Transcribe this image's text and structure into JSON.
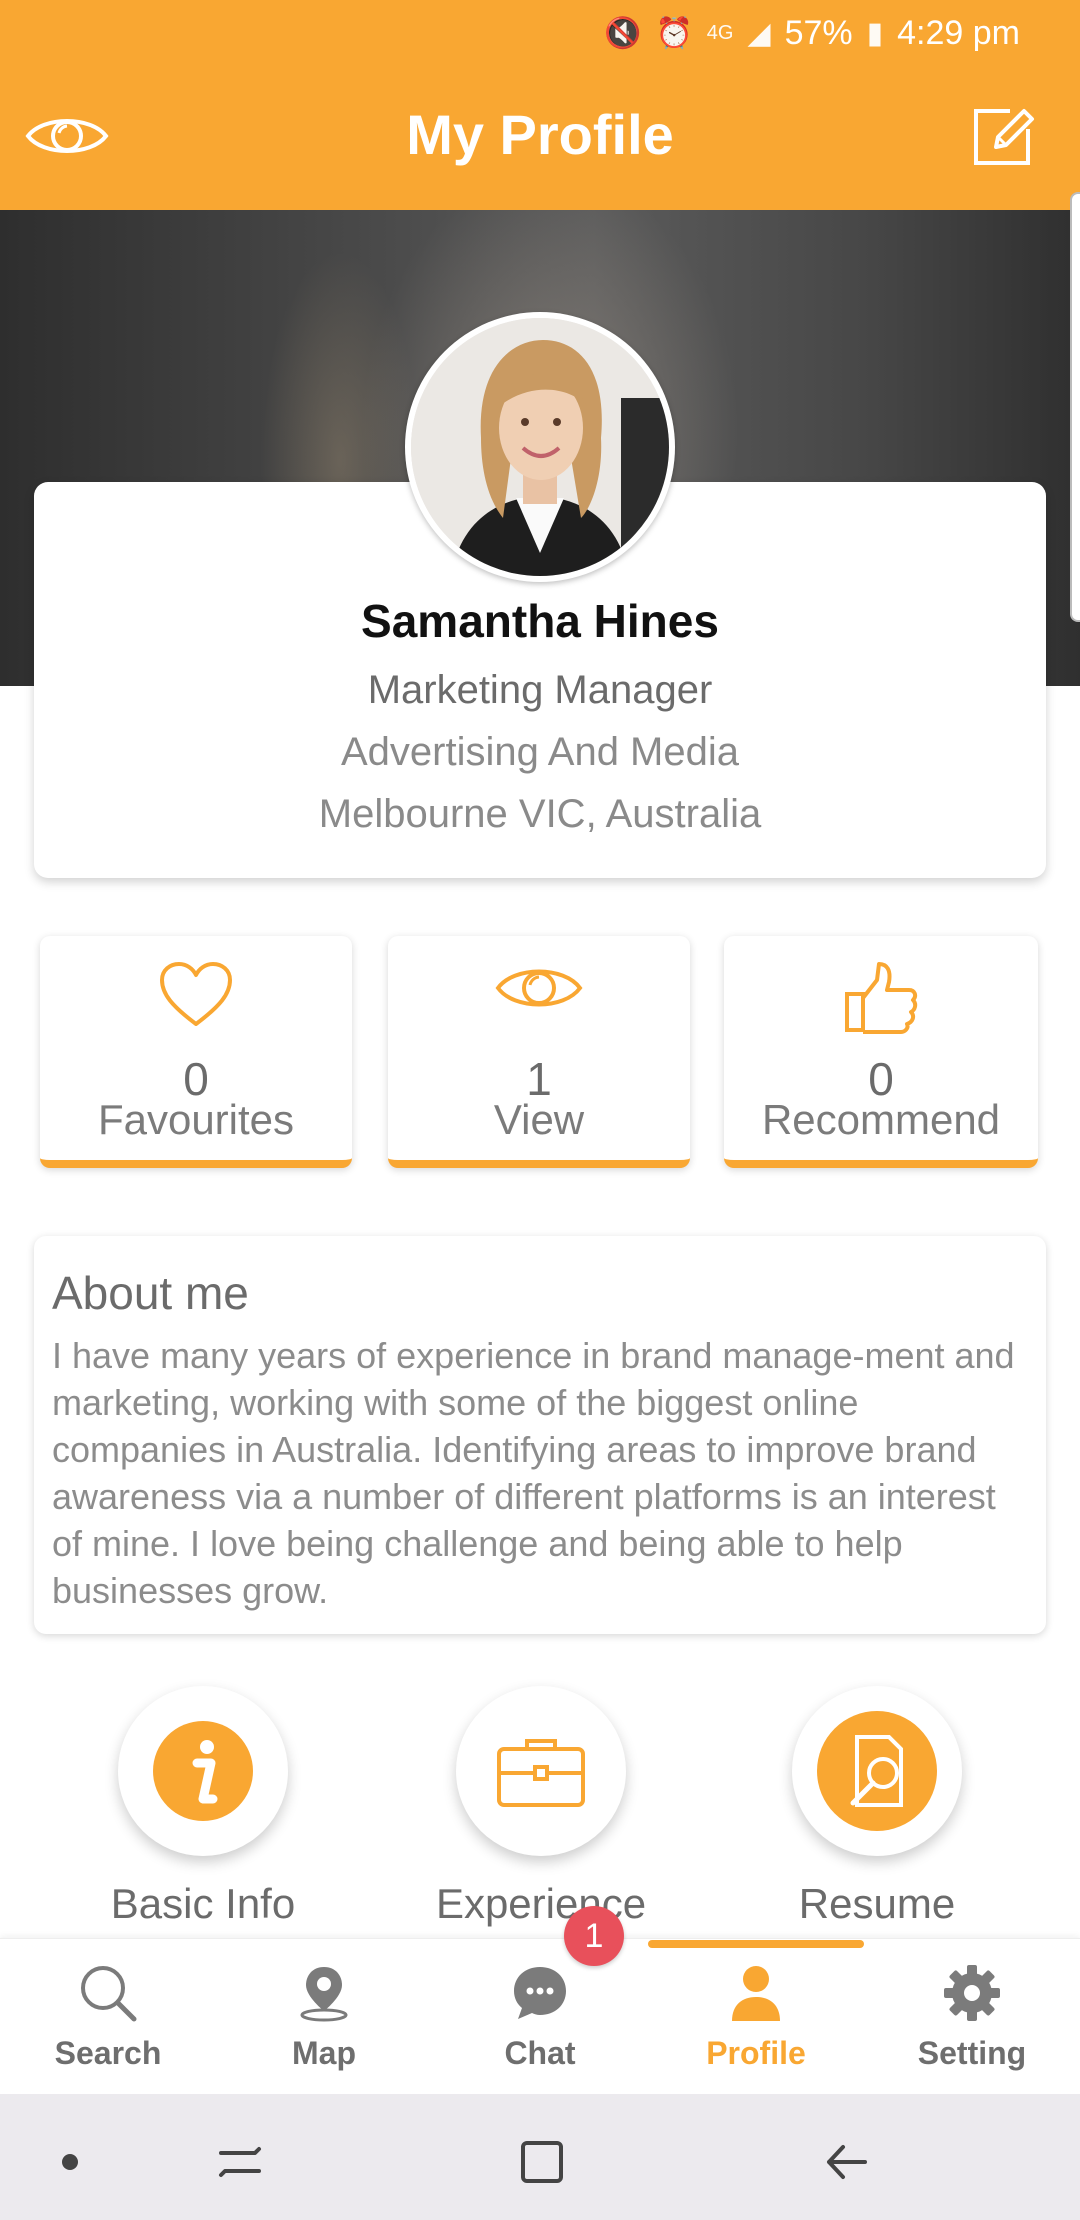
{
  "status_bar": {
    "battery": "57%",
    "time": "4:29 pm",
    "network": "4G"
  },
  "header": {
    "title": "My Profile",
    "left_icon": "eye-icon",
    "right_icon": "edit-icon"
  },
  "profile": {
    "name": "Samantha Hines",
    "job_title": "Marketing Manager",
    "industry": "Advertising And Media",
    "location": "Melbourne VIC, Australia"
  },
  "stats": [
    {
      "icon": "heart-icon",
      "value": "0",
      "label": "Favourites"
    },
    {
      "icon": "eye-icon",
      "value": "1",
      "label": "View"
    },
    {
      "icon": "thumbs-up-icon",
      "value": "0",
      "label": "Recommend"
    }
  ],
  "about": {
    "heading": "About me",
    "text": "I have many years of experience in brand manage-ment and marketing, working with some of the biggest online companies in Australia. Identifying areas to improve brand awareness via a number of different platforms is an interest of mine. I love being challenge and being able to help businesses grow."
  },
  "actions": [
    {
      "icon": "info-icon",
      "label": "Basic Info"
    },
    {
      "icon": "briefcase-icon",
      "label": "Experience"
    },
    {
      "icon": "resume-search-icon",
      "label": "Resume"
    }
  ],
  "nav": {
    "items": [
      {
        "icon": "search-icon",
        "label": "Search"
      },
      {
        "icon": "map-pin-icon",
        "label": "Map"
      },
      {
        "icon": "chat-icon",
        "label": "Chat"
      },
      {
        "icon": "profile-icon",
        "label": "Profile"
      },
      {
        "icon": "gear-icon",
        "label": "Setting"
      }
    ],
    "chat_badge": "1",
    "active": "Profile"
  },
  "colors": {
    "accent": "#f9a732",
    "badge": "#e8505b",
    "text": "#6b6b6b"
  }
}
